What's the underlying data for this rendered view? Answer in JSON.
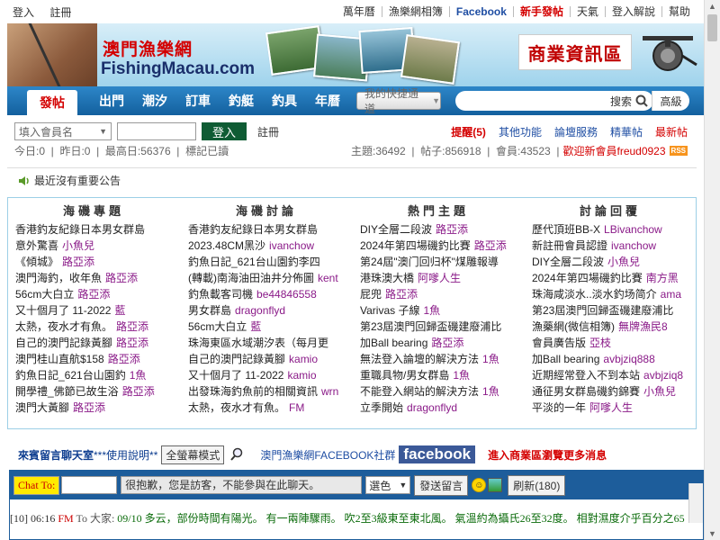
{
  "topbar": {
    "left": [
      "登入",
      "註冊"
    ],
    "right": [
      "萬年曆",
      "漁樂網相簿",
      "Facebook",
      "新手發帖",
      "天氣",
      "登入解說",
      "幫助"
    ]
  },
  "header": {
    "logo_cn": "澳門漁樂網",
    "logo_en": "FishingMacau.com",
    "biz_zone": "商業資訊區"
  },
  "nav": {
    "post": "發帖",
    "items": [
      "出門",
      "潮汐",
      "訂車",
      "釣艇",
      "釣具",
      "年曆"
    ],
    "quick": "我的快捷通道",
    "search": "搜索",
    "advanced": "高級"
  },
  "login": {
    "member_placeholder": "填入會員名",
    "login_btn": "登入",
    "register": "註冊",
    "reminder": "提醒(5)",
    "links": [
      "其他功能",
      "論壇服務",
      "精華帖",
      "最新帖"
    ]
  },
  "stats": {
    "left": "今日:0  |  昨日:0  |  最高日:56376  |  標記已讀",
    "right": "主題:36492  |  帖子:856918  |  會員:43523  |",
    "welcome": "歡迎新會員freud0923",
    "rss": "RSS"
  },
  "notice": "最近沒有重要公告",
  "columns": [
    {
      "title": "海磯專題",
      "items": [
        {
          "t": "香港釣友紀錄日本男女群島",
          "a": ""
        },
        {
          "t": "意外驚喜",
          "a": "小魚兒"
        },
        {
          "t": "《傾城》",
          "a": "路亞添"
        },
        {
          "t": "澳門海釣，收年魚",
          "a": "路亞添"
        },
        {
          "t": "56cm大白立",
          "a": "路亞添"
        },
        {
          "t": "又十個月了 11-2022",
          "a": "藍"
        },
        {
          "t": "太熱，夜水才有魚。",
          "a": "路亞添"
        },
        {
          "t": "自己的澳門記錄黃腳",
          "a": "路亞添"
        },
        {
          "t": "澳門桂山直航$158",
          "a": "路亞添"
        },
        {
          "t": "釣魚日記_621台山園釣",
          "a": "1魚"
        },
        {
          "t": "開學禮_佛節已故生浴",
          "a": "路亞添"
        },
        {
          "t": "澳門大黃腳",
          "a": "路亞添"
        }
      ]
    },
    {
      "title": "海磯討論",
      "items": [
        {
          "t": "香港釣友紀錄日本男女群島",
          "a": ""
        },
        {
          "t": "2023.48CM黑沙",
          "a": "ivanchow"
        },
        {
          "t": "釣魚日記_621台山園釣李四",
          "a": ""
        },
        {
          "t": "(轉載)南海油田油井分佈圖",
          "a": "kent"
        },
        {
          "t": "釣魚載客司機",
          "a": "be44846558"
        },
        {
          "t": "男女群島",
          "a": "dragonflyd"
        },
        {
          "t": "56cm大白立",
          "a": "藍"
        },
        {
          "t": "珠海東區水域潮汐表（每月更",
          "a": ""
        },
        {
          "t": "自己的澳門記錄黃腳",
          "a": "kamio"
        },
        {
          "t": "又十個月了 11-2022",
          "a": "kamio"
        },
        {
          "t": "出發珠海釣魚前的相關資訊",
          "a": "wrn"
        },
        {
          "t": "太熱，夜水才有魚。",
          "a": "FM"
        }
      ]
    },
    {
      "title": "熱門主題",
      "items": [
        {
          "t": "DIY全層二段波",
          "a": "路亞添"
        },
        {
          "t": "2024年第四場磯釣比賽",
          "a": "路亞添"
        },
        {
          "t": "第24屆\"澳门回归杯\"煤雕報導",
          "a": ""
        },
        {
          "t": "港珠澳大橋",
          "a": "阿嗲人生"
        },
        {
          "t": "屁兜",
          "a": "路亞添"
        },
        {
          "t": "Varivas 子線",
          "a": "1魚"
        },
        {
          "t": "第23屆澳門回歸盃磯建廢浦比",
          "a": ""
        },
        {
          "t": "加Ball bearing",
          "a": "路亞添"
        },
        {
          "t": "無法登入論壇的解決方法",
          "a": "1魚"
        },
        {
          "t": "重職具物/男女群島",
          "a": "1魚"
        },
        {
          "t": "不能登入網站的解決方法",
          "a": "1魚"
        },
        {
          "t": "立季開始",
          "a": "dragonflyd"
        }
      ]
    },
    {
      "title": "討論回覆",
      "items": [
        {
          "t": "歷代頂班BB-X",
          "a": "LBivanchow"
        },
        {
          "t": "新註冊會員認證",
          "a": "ivanchow"
        },
        {
          "t": "DIY全層二段波",
          "a": "小魚兒"
        },
        {
          "t": "2024年第四場磯釣比賽",
          "a": "南方黑"
        },
        {
          "t": "珠海咸淡水..淡水釣场简介",
          "a": "ama"
        },
        {
          "t": "第23屆澳門回歸盃磯建廢浦比",
          "a": ""
        },
        {
          "t": "漁藥網(微信相簿)",
          "a": "無牌漁民8"
        },
        {
          "t": "會員廣告版",
          "a": "亞枝"
        },
        {
          "t": "加Ball bearing",
          "a": "avbjziq888"
        },
        {
          "t": "近期經常登入不到本站",
          "a": "avbjziq8"
        },
        {
          "t": "通征男女群島磯釣錦賽",
          "a": "小魚兒"
        },
        {
          "t": "平淡的一年",
          "a": "阿嗲人生"
        }
      ]
    }
  ],
  "chat": {
    "title": "來賓留言聊天室",
    "help": "***使用說明**",
    "fullscreen": "全螢幕模式",
    "fb_group": "澳門漁樂網FACEBOOK社群",
    "fb_logo": "facebook",
    "biz_link": "進入商業區瀏覽更多消息",
    "to_label": "Chat To:",
    "guest_msg": "很抱歉，您是訪客，不能參與在此聊天。",
    "color": "選色",
    "send": "發送留言",
    "refresh": "刷新(180)",
    "log": {
      "time": "[10] 06:16",
      "from": "FM",
      "to": "To 大家:",
      "msg": "09/10 多云，部份時間有陽光。 有一兩陣驟雨。 吹2至3級東至東北風。 氣溫約為攝氏26至32度。 相對濕度介乎百分之65"
    }
  }
}
